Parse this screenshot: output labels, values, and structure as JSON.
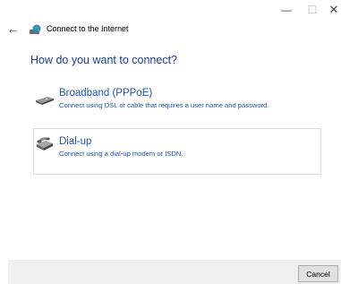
{
  "window": {
    "controls": {
      "minimize": "—",
      "maximize": "☐",
      "close": "✕"
    }
  },
  "nav": {
    "back_icon": "back-arrow-icon",
    "app_icon": "network-globe-icon",
    "title": "Connect to the Internet"
  },
  "main": {
    "heading": "How do you want to connect?",
    "options": [
      {
        "title": "Broadband (PPPoE)",
        "description": "Connect using DSL or cable that requires a user name and password.",
        "icon": "broadband-modem-icon",
        "selected": false
      },
      {
        "title": "Dial-up",
        "description": "Connect using a dial-up modem or ISDN.",
        "icon": "dialup-modem-icon",
        "selected": true
      }
    ]
  },
  "footer": {
    "cancel_label": "Cancel"
  },
  "colors": {
    "heading": "#1e3f8f",
    "link": "#1a55b8",
    "footer_bg": "#f0f0f0",
    "selected_border": "#dcdcdc"
  }
}
